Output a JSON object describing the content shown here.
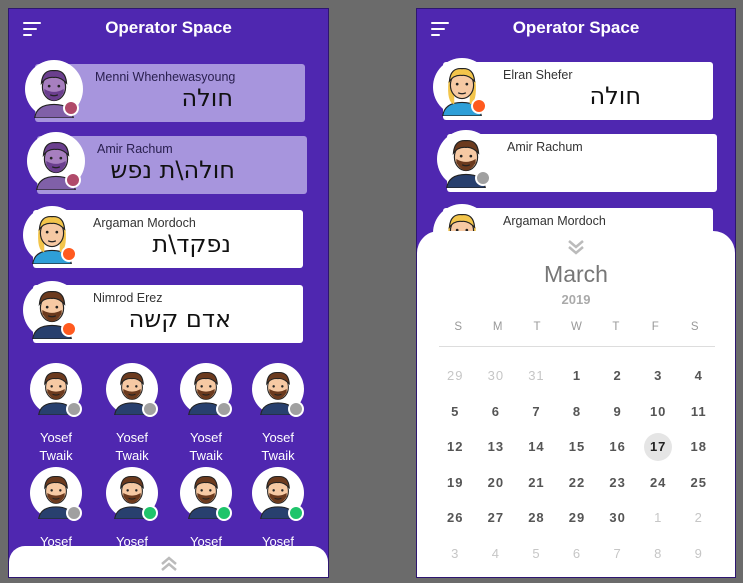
{
  "left": {
    "app_title": "Operator Space",
    "cards": [
      {
        "name": "Menni Whenhewasyoung",
        "status": "חולה",
        "dot": "#b04a6a",
        "style": "dim"
      },
      {
        "name": "Amir Rachum",
        "status": "חולה\\ת נפש",
        "dot": "#b04a6a",
        "style": "dim"
      },
      {
        "name": "Argaman Mordoch",
        "status": "נפקד\\ת",
        "dot": "#ff5a1f",
        "style": "white"
      },
      {
        "name": "Nimrod Erez",
        "status": "אדם קשה",
        "dot": "#ff5a1f",
        "style": "white"
      }
    ],
    "grid": [
      {
        "first": "Yosef",
        "last": "Twaik",
        "dot": "#a0a0a0"
      },
      {
        "first": "Yosef",
        "last": "Twaik",
        "dot": "#a0a0a0"
      },
      {
        "first": "Yosef",
        "last": "Twaik",
        "dot": "#a0a0a0"
      },
      {
        "first": "Yosef",
        "last": "Twaik",
        "dot": "#a0a0a0"
      },
      {
        "first": "Yosef",
        "last": "",
        "dot": "#a0a0a0"
      },
      {
        "first": "Yosef",
        "last": "",
        "dot": "#1fc46b"
      },
      {
        "first": "Yosef",
        "last": "",
        "dot": "#1fc46b"
      },
      {
        "first": "Yosef",
        "last": "",
        "dot": "#1fc46b"
      }
    ]
  },
  "right": {
    "app_title": "Operator Space",
    "cards": [
      {
        "name": "Elran Shefer",
        "status": "חולה",
        "dot": "#ff5a1f"
      },
      {
        "name": "Amir Rachum",
        "status": "",
        "dot": "#a0a0a0"
      },
      {
        "name": "Argaman Mordoch",
        "status": "",
        "dot": ""
      }
    ],
    "calendar": {
      "month": "March",
      "year": "2019",
      "weekdays": [
        "S",
        "M",
        "T",
        "W",
        "T",
        "F",
        "S"
      ],
      "weeks": [
        [
          {
            "d": "29",
            "m": true
          },
          {
            "d": "30",
            "m": true
          },
          {
            "d": "31",
            "m": true
          },
          {
            "d": "1"
          },
          {
            "d": "2"
          },
          {
            "d": "3"
          },
          {
            "d": "4"
          }
        ],
        [
          {
            "d": "5"
          },
          {
            "d": "6"
          },
          {
            "d": "7"
          },
          {
            "d": "8"
          },
          {
            "d": "9"
          },
          {
            "d": "10"
          },
          {
            "d": "11"
          }
        ],
        [
          {
            "d": "12"
          },
          {
            "d": "13"
          },
          {
            "d": "14"
          },
          {
            "d": "15"
          },
          {
            "d": "16"
          },
          {
            "d": "17",
            "today": true
          },
          {
            "d": "18"
          }
        ],
        [
          {
            "d": "19"
          },
          {
            "d": "20"
          },
          {
            "d": "21"
          },
          {
            "d": "22"
          },
          {
            "d": "23"
          },
          {
            "d": "24"
          },
          {
            "d": "25"
          }
        ],
        [
          {
            "d": "26"
          },
          {
            "d": "27"
          },
          {
            "d": "28"
          },
          {
            "d": "29"
          },
          {
            "d": "30"
          },
          {
            "d": "1",
            "m": true
          },
          {
            "d": "2",
            "m": true
          }
        ],
        [
          {
            "d": "3",
            "m": true
          },
          {
            "d": "4",
            "m": true
          },
          {
            "d": "5",
            "m": true
          },
          {
            "d": "6",
            "m": true
          },
          {
            "d": "7",
            "m": true
          },
          {
            "d": "8",
            "m": true
          },
          {
            "d": "9",
            "m": true
          }
        ]
      ]
    }
  },
  "colors": {
    "primary": "#4f27b0",
    "card_dim": "#a795dd",
    "today_bg": "#e5e5e5"
  }
}
